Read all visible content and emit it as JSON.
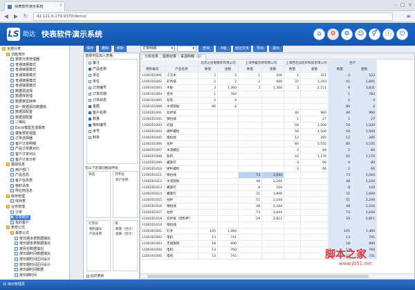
{
  "browser": {
    "tab_title": "快表软件演示系统",
    "close": "×",
    "url": "42.121.6.179:9370/demo/",
    "controls": [
      "–",
      "□",
      "×"
    ],
    "nav": [
      "◀",
      "▶",
      "↻"
    ],
    "menu": "≡"
  },
  "app": {
    "logo_text": "LS",
    "brand": "助达",
    "title": "快表软件演示系统",
    "header_buttons": [
      "⌂",
      "⚙",
      "⚙",
      "☺",
      "⚥",
      "ⓘ",
      "⏻"
    ]
  },
  "tree": [
    {
      "label": "全部分类",
      "indent": 0,
      "folder": true
    },
    {
      "label": "功能演示",
      "indent": 1,
      "folder": true
    },
    {
      "label": "报表分类管理器",
      "indent": 2,
      "folder": false
    },
    {
      "label": "普通填报模式",
      "indent": 2,
      "folder": false
    },
    {
      "label": "普通填报模式",
      "indent": 2,
      "folder": false
    },
    {
      "label": "普通填报模式",
      "indent": 2,
      "folder": false
    },
    {
      "label": "普通填报模式",
      "indent": 2,
      "folder": false
    },
    {
      "label": "普通填报模式",
      "indent": 2,
      "folder": false
    },
    {
      "label": "数据源选择",
      "indent": 2,
      "folder": false
    },
    {
      "label": "数据库管理",
      "indent": 2,
      "folder": false
    },
    {
      "label": "数据类型转换",
      "indent": 2,
      "folder": false
    },
    {
      "label": "单一数据源向数据库",
      "indent": 2,
      "folder": false
    },
    {
      "label": "数据源配置",
      "indent": 2,
      "folder": false
    },
    {
      "label": "数据源配置",
      "indent": 2,
      "folder": false
    },
    {
      "label": "二维码",
      "indent": 2,
      "folder": false
    },
    {
      "label": "Excel模型生成报表",
      "indent": 2,
      "folder": false
    },
    {
      "label": "模板预览视图",
      "indent": 2,
      "folder": false
    },
    {
      "label": "订单选择器",
      "indent": 2,
      "folder": false
    },
    {
      "label": "客户订单明细",
      "indent": 2,
      "folder": false
    },
    {
      "label": "产品订单量对比",
      "indent": 2,
      "folder": false
    },
    {
      "label": "客户订单对比",
      "indent": 2,
      "folder": false
    },
    {
      "label": "客户订单分析",
      "indent": 2,
      "folder": false
    },
    {
      "label": "基础信息",
      "indent": 1,
      "folder": true
    },
    {
      "label": "用户部门",
      "indent": 2,
      "folder": false
    },
    {
      "label": "产品信息",
      "indent": 2,
      "folder": false
    },
    {
      "label": "客户信息表",
      "indent": 2,
      "folder": false
    },
    {
      "label": "物料清单",
      "indent": 2,
      "folder": false
    },
    {
      "label": "供应商信息",
      "indent": 2,
      "folder": false
    },
    {
      "label": "库存管理",
      "indent": 1,
      "folder": true
    },
    {
      "label": "库存表",
      "indent": 2,
      "folder": false
    },
    {
      "label": "业务管理",
      "indent": 1,
      "folder": true
    },
    {
      "label": "订单",
      "indent": 2,
      "folder": false
    },
    {
      "label": "订单统计",
      "indent": 2,
      "folder": false,
      "selected": true
    },
    {
      "label": "我的客户",
      "indent": 2,
      "folder": false
    },
    {
      "label": "表样公式",
      "indent": 1,
      "folder": true
    },
    {
      "label": "报表公式",
      "indent": 2,
      "folder": true
    },
    {
      "label": "按日期多表数据填充",
      "indent": 3,
      "folder": false
    },
    {
      "label": "按日期多表数据填充",
      "indent": 3,
      "folder": false
    },
    {
      "label": "按月份数据填充",
      "indent": 3,
      "folder": false
    },
    {
      "label": "按日期时间数据填充",
      "indent": 3,
      "folder": false
    },
    {
      "label": "按日期时间区间设计",
      "indent": 3,
      "folder": false
    },
    {
      "label": "按日期时间区间设计",
      "indent": 3,
      "folder": false
    },
    {
      "label": "按日期时间数据",
      "indent": 3,
      "folder": false
    },
    {
      "label": "按日期时间",
      "indent": 3,
      "folder": false
    }
  ],
  "toolbar": {
    "buttons": [
      "保存",
      "删除",
      "刷新"
    ],
    "select_value": "订单明细",
    "select_value2": "",
    "buttons2": [
      "查询",
      "X轴",
      "组合交叉",
      "导出",
      "退出"
    ]
  },
  "field_panel": {
    "title": "选择字段加入表格",
    "fields": [
      {
        "label": "备注",
        "checked": false
      },
      {
        "label": "产品名称",
        "checked": true
      },
      {
        "label": "单位",
        "checked": false
      },
      {
        "label": "单位",
        "checked": false
      },
      {
        "label": "订单编号",
        "checked": false
      },
      {
        "label": "订单日期",
        "checked": false
      },
      {
        "label": "订单状态",
        "checked": false
      },
      {
        "label": "金额",
        "checked": true
      },
      {
        "label": "客户名称",
        "checked": true
      },
      {
        "label": "数量",
        "checked": true
      },
      {
        "label": "物料编号",
        "checked": true
      },
      {
        "label": "序号",
        "checked": false
      },
      {
        "label": "制单",
        "checked": false
      }
    ],
    "zone_label": "在以下区域间拖动字段",
    "filter_zone": "筛选",
    "column_zone": "列字段",
    "column_items": [
      "客户名称"
    ],
    "row_zone": "行字段",
    "row_items": [
      "物料编号",
      "产品名称"
    ],
    "value_zone": "值",
    "value_items": [
      "数量（合计）",
      "金额（合计）"
    ],
    "defer_label": "延迟更新"
  },
  "grid": {
    "tabs": [
      "分析结果",
      "图表结果",
      "来源明细（1）"
    ],
    "customers": [
      "北京沁古春服装有限公司",
      "上海伟媛贸易有限公司",
      "上海西北弘纺织科技有限公司"
    ],
    "total_label": "合计",
    "sub_headers": [
      "数量",
      "金额"
    ],
    "row_headers": [
      "物料编号",
      "产品名称"
    ],
    "rows": [
      [
        "1100101001",
        "小方木",
        "2",
        "2",
        "1",
        "200",
        "1",
        "321",
        "4",
        "523"
      ],
      [
        "1100101002",
        "彩色纸",
        "2",
        "2",
        "2",
        "600",
        "37",
        "1,243",
        "41",
        "1,845"
      ],
      [
        "1100101003",
        "木板",
        "3",
        "1,360",
        "3",
        "1,360",
        "3",
        "2,111",
        "9",
        "3,831"
      ],
      [
        "1100101004",
        "瓷木",
        "1",
        "783",
        "",
        "",
        "",
        "",
        "1",
        "783"
      ],
      [
        "1100101005",
        "铅笔",
        "2",
        "4",
        "",
        "",
        "",
        "",
        "2",
        "4"
      ],
      [
        "1100101006",
        "水泥管板",
        "80",
        "4",
        "",
        "",
        "",
        "",
        "80",
        "4"
      ],
      [
        "1100201001",
        "双折纸",
        "",
        "",
        "",
        "",
        "40",
        "960",
        "40",
        "960"
      ],
      [
        "1100201002",
        "钢拉线",
        "",
        "",
        "",
        "",
        "1",
        "27",
        "1",
        "27"
      ],
      [
        "1100201003",
        "托盘",
        "",
        "",
        "",
        "",
        "50",
        "1,500",
        "50",
        "1,500"
      ],
      [
        "1100201004",
        "硬杆螺栓",
        "",
        "",
        "",
        "",
        "50",
        "1,500",
        "50",
        "1,500"
      ],
      [
        "1100201005",
        "钢拉线",
        "",
        "",
        "",
        "",
        "12",
        "285",
        "12",
        "285"
      ],
      [
        "1100201006",
        "拉杆",
        "",
        "",
        "",
        "",
        "80",
        "5,535",
        "80",
        "5,535"
      ],
      [
        "1100201007",
        "水泥螺丝",
        "",
        "",
        "",
        "",
        "2",
        "84",
        "2",
        "84"
      ],
      [
        "1100201008",
        "轨机",
        "",
        "",
        "",
        "",
        "42",
        "1,176",
        "42",
        "1,176"
      ],
      [
        "1100201009",
        "螺旋钉",
        "",
        "",
        "",
        "",
        "4",
        "80",
        "4",
        "80"
      ],
      [
        "1100201010",
        "硬杆螺栓",
        "",
        "",
        "",
        "",
        "2",
        "66",
        "2",
        "66"
      ],
      [
        "1100201011",
        "钢拉线",
        "",
        "",
        "73",
        "2,644",
        "",
        "",
        "73",
        "2,644"
      ],
      [
        "1100201012",
        "水泥管板",
        "",
        "",
        "48",
        "2,244",
        "",
        "",
        "48",
        "2,244"
      ],
      [
        "1100201013",
        "螺旋钉",
        "",
        "",
        "8",
        "104",
        "",
        "",
        "8",
        "104"
      ],
      [
        "1100201014",
        "螺旋钉",
        "",
        "",
        "21",
        "1,840",
        "",
        "",
        "21",
        "1,840"
      ],
      [
        "1100201015",
        "拉杆",
        "",
        "",
        "51",
        "2,244",
        "",
        "",
        "51",
        "2,244"
      ],
      [
        "1100201016",
        "钢拉线",
        "",
        "",
        "48",
        "2,244",
        "",
        "",
        "48",
        "2,244"
      ],
      [
        "1100201017",
        "拉杆",
        "",
        "",
        "73",
        "2,644",
        "",
        "",
        "73",
        "2,644"
      ],
      [
        "1100201018",
        "双折纸（塑料杯）",
        "",
        "",
        "29",
        "2,811",
        "",
        "",
        "29",
        "2,811"
      ],
      [
        "1100201019",
        "钢拉线",
        "",
        "",
        "",
        "",
        "",
        "",
        "",
        ""
      ],
      [
        "1100301001",
        "钉条",
        "105",
        "1,460",
        "",
        "",
        "",
        "",
        "105",
        "1,460"
      ],
      [
        "1100301002",
        "电机",
        "13",
        "741",
        "",
        "",
        "",
        "",
        "13",
        "741"
      ],
      [
        "1100301003",
        "无缝钢管",
        "18",
        "890",
        "",
        "",
        "",
        "",
        "18",
        "890"
      ],
      [
        "1100301004",
        "电机",
        "13",
        "760",
        "",
        "",
        "",
        "",
        "13",
        "760"
      ],
      [
        "1100301005",
        "电机",
        "13",
        "741",
        "",
        "",
        "",
        "",
        "13",
        "741"
      ]
    ]
  },
  "status": {
    "user": "演示管理员"
  },
  "watermark": {
    "text": "脚本之家",
    "url": "www.jb51.net"
  }
}
